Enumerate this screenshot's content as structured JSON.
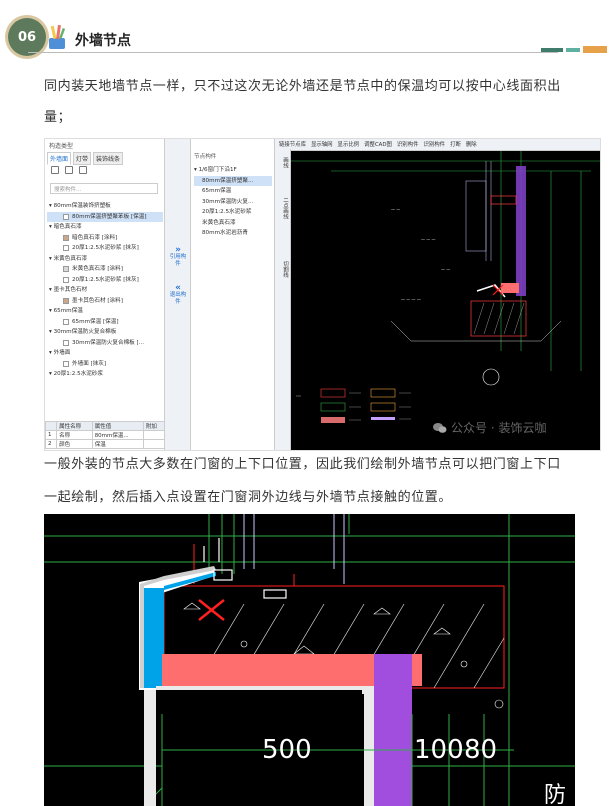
{
  "section": {
    "number": "06",
    "title": "外墙节点"
  },
  "paragraphs": [
    "同内装天地墙节点一样，只不过这次无论外墙还是节点中的保温均可以按中心线面积出",
    "量；",
    "一般外装的节点大多数在门窗的上下口位置，因此我们绘制外墙节点可以把门窗上下口",
    "一起绘制，然后插入点设置在门窗洞外边线与外墙节点接触的位置。"
  ],
  "screenshot1": {
    "left_panel": {
      "caption": "构造类型",
      "tabs": [
        "外墙面",
        "灯带",
        "装饰线条"
      ],
      "active_tab": 0,
      "search_placeholder": "搜索构件...",
      "tree": [
        {
          "type": "grp",
          "label": "▾ 80mm保温装饰挤塑板"
        },
        {
          "type": "itm",
          "label": "80mm保温挤塑聚苯板 [保温]",
          "swatch": "#ffffff",
          "selected": true
        },
        {
          "type": "grp",
          "label": "▾ 暗色真石漆"
        },
        {
          "type": "itm",
          "label": "暗色真石漆 [涂料]",
          "swatch": "#c9a98a"
        },
        {
          "type": "itm",
          "label": "20厚1:2.5水泥砂浆 [抹灰]",
          "swatch": "#ffffff"
        },
        {
          "type": "grp",
          "label": "▾ 米黄色真石漆"
        },
        {
          "type": "itm",
          "label": "米黄色真石漆 [涂料]",
          "swatch": "#d8d8d8"
        },
        {
          "type": "itm",
          "label": "20厚1:2.5水泥砂浆 [抹灰]",
          "swatch": "#ffffff"
        },
        {
          "type": "grp",
          "label": "▾ 墨卡其色石材"
        },
        {
          "type": "itm",
          "label": "墨卡其色石材 [涂料]",
          "swatch": "#c9a98a"
        },
        {
          "type": "grp",
          "label": "▾ 65mm保温"
        },
        {
          "type": "itm",
          "label": "65mm保温 [保温]",
          "swatch": "#ffffff"
        },
        {
          "type": "grp",
          "label": "▾ 30mm保温防火复合棉板"
        },
        {
          "type": "itm",
          "label": "30mm保温防火复合棉板 [...",
          "swatch": "#ffffff"
        },
        {
          "type": "grp",
          "label": "▾ 外墙面"
        },
        {
          "type": "itm",
          "label": "外墙面 [抹灰]",
          "swatch": "#ffffff"
        },
        {
          "type": "grp",
          "label": "▾ 20厚1:2.5水泥砂浆"
        }
      ],
      "props_header": [
        "",
        "属性名称",
        "属性值",
        "附加"
      ],
      "props_rows": [
        [
          "1",
          "名称",
          "80mm保温...",
          ""
        ],
        [
          "2",
          "颜色",
          "保温",
          ""
        ]
      ]
    },
    "mid_buttons": [
      {
        "arrow": "»",
        "label": "引用构件"
      },
      {
        "arrow": "«",
        "label": "退出构件"
      }
    ],
    "node_panel": {
      "caption": "节点构件",
      "rows": [
        {
          "label": "▾ 1/6窗门下沿1F",
          "root": true
        },
        {
          "label": "80mm保温挤塑聚...",
          "selected": true
        },
        {
          "label": "65mm保温"
        },
        {
          "label": "30mm保温防火复..."
        },
        {
          "label": "20厚1:2.5水泥砂浆"
        },
        {
          "label": "米黄色真石漆"
        },
        {
          "label": "80mm水泥岩沥青"
        }
      ]
    },
    "vertical_buttons": [
      "画线",
      "二点画线",
      "切割线"
    ],
    "toolbar": [
      "链接节点库",
      "显示轴网",
      "显示比例",
      "调整CAD图",
      "识别构件",
      "识别构件",
      "打断",
      "删除"
    ],
    "watermark": "公众号 · 装饰云咖"
  },
  "screenshot2": {
    "dims": [
      "500",
      "100",
      "80"
    ],
    "corner_text": "防"
  },
  "colors": {
    "badge": "#5e7a5c",
    "blue_fill": "#00a3e8",
    "pink_fill": "#ff6e6e",
    "purple_fill": "#a14dde",
    "cad_bg": "#000000"
  }
}
